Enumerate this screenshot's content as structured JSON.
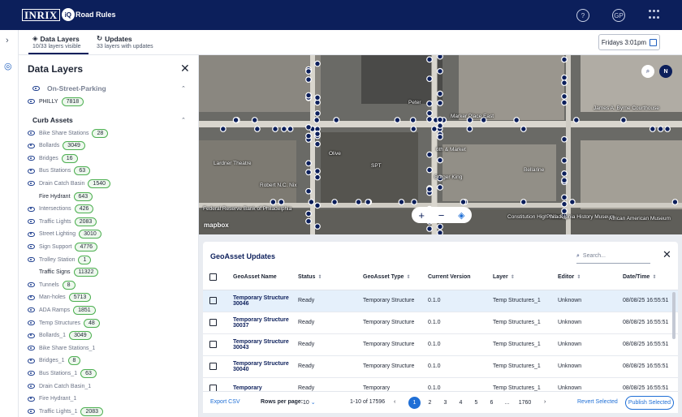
{
  "header": {
    "logo": "INRIX",
    "logo_badge": "iQ",
    "app_name": "Road Rules",
    "profile_initials": "GP"
  },
  "subbar": {
    "tab_layers": {
      "title": "Data Layers",
      "subtitle": "10/33 layers visible"
    },
    "tab_updates": {
      "title": "Updates",
      "subtitle": "33 layers with updates"
    },
    "time_button": "Fridays 3:01pm"
  },
  "panel": {
    "title": "Data Layers",
    "group1": "On-Street-Parking",
    "group1_items": [
      {
        "label": "PHILLY",
        "count": "7818"
      }
    ],
    "group2": "Curb Assets",
    "group2_items": [
      {
        "label": "Bike Share Stations",
        "count": "28",
        "active": false
      },
      {
        "label": "Bollards",
        "count": "3049",
        "active": false
      },
      {
        "label": "Bridges",
        "count": "16",
        "active": false
      },
      {
        "label": "Bus Stations",
        "count": "63",
        "active": false
      },
      {
        "label": "Drain Catch Basin",
        "count": "1540",
        "active": false
      },
      {
        "label": "Fire Hydrant",
        "count": "643",
        "active": true
      },
      {
        "label": "Intersections",
        "count": "426",
        "active": false
      },
      {
        "label": "Traffic Lights",
        "count": "2083",
        "active": false
      },
      {
        "label": "Street Lighting",
        "count": "3010",
        "active": false
      },
      {
        "label": "Sign Support",
        "count": "4776",
        "active": false
      },
      {
        "label": "Trolley Station",
        "count": "1",
        "active": false
      },
      {
        "label": "Traffic Signs",
        "count": "11322",
        "active": true
      },
      {
        "label": "Tunnels",
        "count": "8",
        "active": false
      },
      {
        "label": "Man-holes",
        "count": "5713",
        "active": false
      },
      {
        "label": "ADA Ramps",
        "count": "1851",
        "active": false
      },
      {
        "label": "Temp Structures",
        "count": "48",
        "active": false
      },
      {
        "label": "Bollards_1",
        "count": "3049",
        "active": false
      },
      {
        "label": "Bike Share Stations_1",
        "count": "",
        "active": false
      },
      {
        "label": "Bridges_1",
        "count": "8",
        "active": false
      },
      {
        "label": "Bus Stations_1",
        "count": "63",
        "active": false
      },
      {
        "label": "Drain Catch Basin_1",
        "count": "",
        "active": false
      },
      {
        "label": "Fire Hydrant_1",
        "count": "",
        "active": false
      },
      {
        "label": "Traffic Lights_1",
        "count": "2083",
        "active": false
      }
    ]
  },
  "map": {
    "labels": [
      "Marker Place East",
      "6th & Market",
      "Burger King",
      "Robert N.C. Nix",
      "Lardner Theatre",
      "James A. Byrne Courthouse",
      "Federal Reserve Bank of Philadelphia",
      "Constitution High School",
      "Philadelphia History Museum",
      "African American Museum",
      "SPT",
      "Olive",
      "Bellarine",
      "Peter"
    ],
    "attribution": "mapbox",
    "zoom_in": "+",
    "zoom_out": "−"
  },
  "table": {
    "title": "GeoAsset Updates",
    "search_placeholder": "Search...",
    "columns": [
      "GeoAsset Name",
      "Status",
      "GeoAsset Type",
      "Current Version",
      "Layer",
      "Editor",
      "Date/Time"
    ],
    "rows": [
      {
        "name": "Temporary Structure 30046",
        "status": "Ready",
        "type": "Temporary Structure",
        "version": "0.1.0",
        "layer": "Temp Structures_1",
        "editor": "Unknown",
        "datetime": "08/08/25 16:55:51"
      },
      {
        "name": "Temporary Structure 30037",
        "status": "Ready",
        "type": "Temporary Structure",
        "version": "0.1.0",
        "layer": "Temp Structures_1",
        "editor": "Unknown",
        "datetime": "08/08/25 16:55:51"
      },
      {
        "name": "Temporary Structure 30043",
        "status": "Ready",
        "type": "Temporary Structure",
        "version": "0.1.0",
        "layer": "Temp Structures_1",
        "editor": "Unknown",
        "datetime": "08/08/25 16:55:51"
      },
      {
        "name": "Temporary Structure 30040",
        "status": "Ready",
        "type": "Temporary Structure",
        "version": "0.1.0",
        "layer": "Temp Structures_1",
        "editor": "Unknown",
        "datetime": "08/08/25 16:55:51"
      },
      {
        "name": "Temporary",
        "status": "Ready",
        "type": "Temporary",
        "version": "0.1.0",
        "layer": "Temp Structures_1",
        "editor": "Unknown",
        "datetime": "08/08/25 16:55:51"
      }
    ],
    "footer": {
      "export": "Export CSV",
      "rows_per_page_label": "Rows per page:",
      "rows_per_page": "10",
      "range": "1-10 of 17596",
      "pages": [
        "1",
        "2",
        "3",
        "4",
        "5",
        "6",
        "...",
        "1760"
      ],
      "revert": "Revert Selected",
      "publish": "Publish Selected"
    }
  },
  "colors": {
    "navy": "#0c1f5b",
    "accent": "#1f6fd6",
    "badge_green": "#4caf50"
  }
}
